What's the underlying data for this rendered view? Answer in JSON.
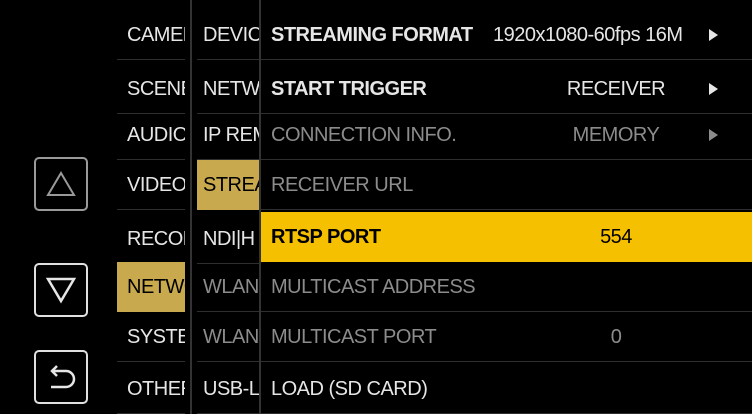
{
  "nav": {
    "up_icon": "up-triangle-icon",
    "down_icon": "down-triangle-icon",
    "back_icon": "return-arrow-icon"
  },
  "menu_col1": [
    "CAMER",
    "SCENE",
    "AUDIO",
    "VIDEO",
    "RECORI",
    "NETWO",
    "SYSTEM",
    "OTHERS"
  ],
  "menu_col2": [
    "DEVIC",
    "NETW",
    "IP REM",
    "STREA",
    "NDI|H",
    "WLAN",
    "WLAN",
    "USB-LA"
  ],
  "settings": {
    "streaming_format": {
      "label": "STREAMING FORMAT",
      "value": "1920x1080-60fps 16M"
    },
    "start_trigger": {
      "label": "START TRIGGER",
      "value": "RECEIVER"
    },
    "connection_info": {
      "label": "CONNECTION INFO.",
      "value": "MEMORY"
    },
    "receiver_url": {
      "label": "RECEIVER URL"
    },
    "rtsp_port": {
      "label": "RTSP PORT",
      "value": "554"
    },
    "multicast_address": {
      "label": "MULTICAST ADDRESS"
    },
    "multicast_port": {
      "label": "MULTICAST PORT",
      "value": "0"
    },
    "load_sd": {
      "label": "LOAD (SD CARD)"
    }
  },
  "colors": {
    "highlight_yellow": "#f5c000",
    "highlight_gold": "#c8a94e"
  }
}
